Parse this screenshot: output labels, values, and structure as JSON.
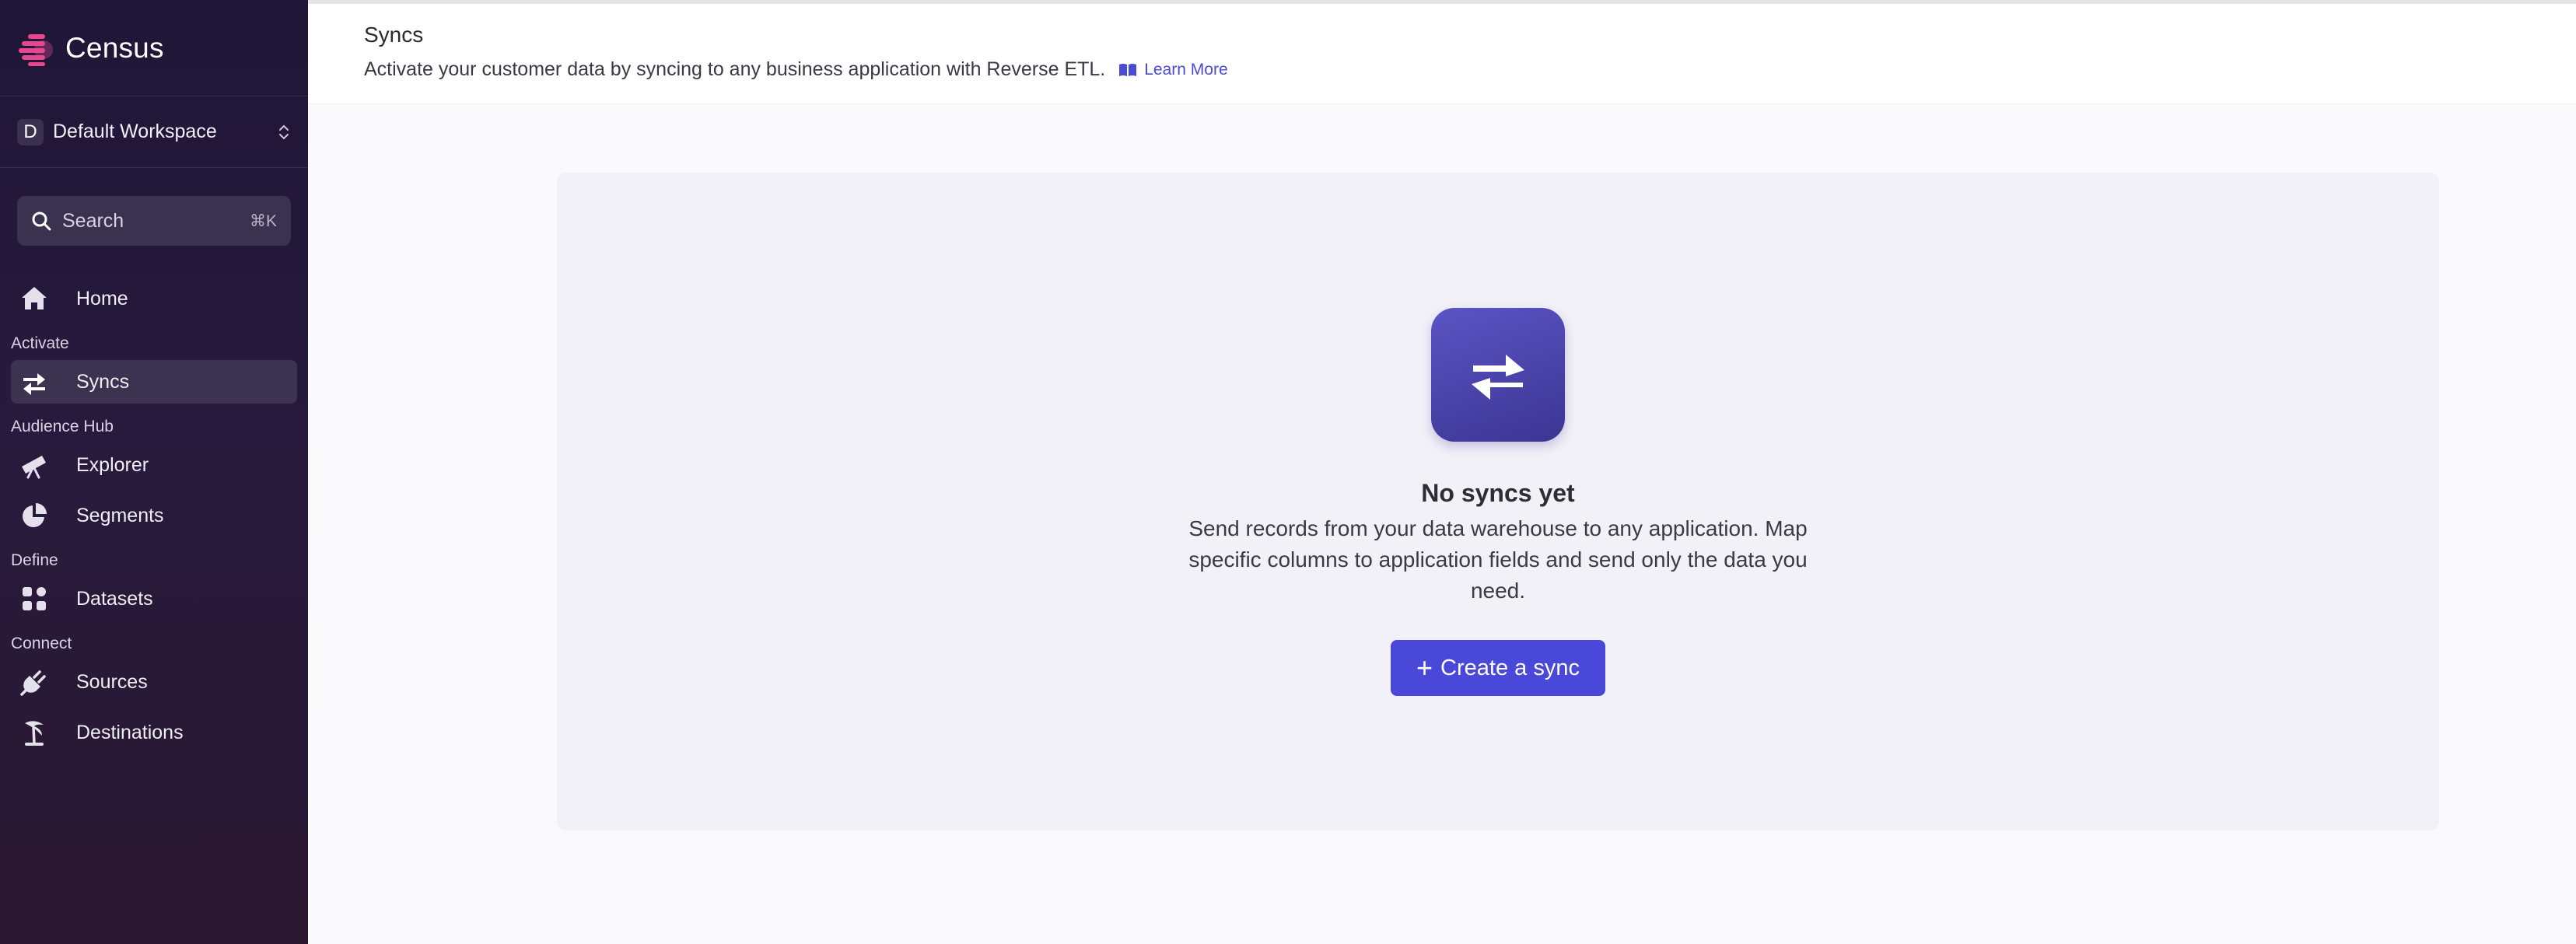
{
  "brand": {
    "name": "Census",
    "accent": "#e8478f"
  },
  "workspace": {
    "initial": "D",
    "name": "Default Workspace"
  },
  "search": {
    "label": "Search",
    "shortcut": "⌘K"
  },
  "nav": {
    "home": {
      "label": "Home",
      "icon": "home-icon"
    },
    "sections": {
      "activate": "Activate",
      "audience_hub": "Audience Hub",
      "define": "Define",
      "connect": "Connect"
    },
    "syncs": {
      "label": "Syncs",
      "icon": "syncs-icon",
      "active": true
    },
    "explorer": {
      "label": "Explorer",
      "icon": "telescope-icon"
    },
    "segments": {
      "label": "Segments",
      "icon": "pie-chart-icon"
    },
    "datasets": {
      "label": "Datasets",
      "icon": "grid-icon"
    },
    "sources": {
      "label": "Sources",
      "icon": "plug-icon"
    },
    "destinations": {
      "label": "Destinations",
      "icon": "palm-tree-icon"
    }
  },
  "header": {
    "title": "Syncs",
    "subtitle": "Activate your customer data by syncing to any business application with Reverse ETL.",
    "learn_more": "Learn More"
  },
  "empty_state": {
    "title": "No syncs yet",
    "description": "Send records from your data warehouse to any application. Map specific columns to application fields and send only the data you need.",
    "button": "Create a sync"
  },
  "colors": {
    "sidebar_bg": "#241a3a",
    "primary_button": "#4a48d8",
    "link": "#4a4ad6"
  }
}
